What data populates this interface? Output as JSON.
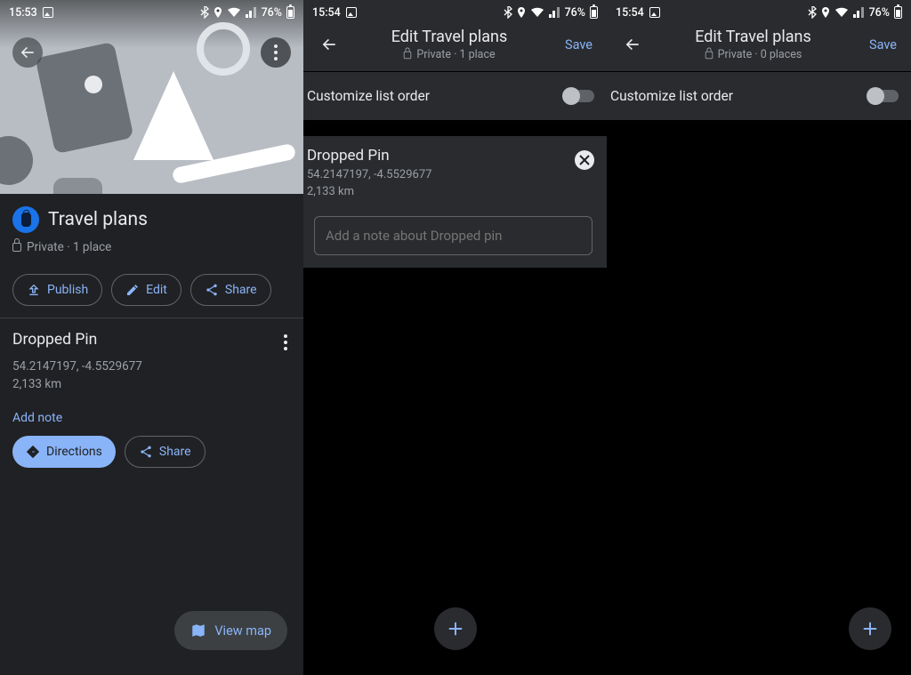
{
  "status": {
    "time1": "15:53",
    "time2": "15:54",
    "time3": "15:54",
    "battery": "76%"
  },
  "pane1": {
    "title": "Travel plans",
    "privacy": "Private · 1 place",
    "actions": {
      "publish": "Publish",
      "edit": "Edit",
      "share": "Share"
    },
    "place": {
      "title": "Dropped Pin",
      "coords": "54.2147197, -4.5529677",
      "distance": "2,133 km",
      "add_note": "Add note",
      "directions": "Directions",
      "share": "Share"
    },
    "view_map": "View map"
  },
  "pane2": {
    "header_title": "Edit Travel plans",
    "header_sub": "Private · 1 place",
    "save": "Save",
    "customize": "Customize list order",
    "pin": {
      "title": "Dropped Pin",
      "coords": "54.2147197, -4.5529677",
      "distance": "2,133 km",
      "note_placeholder": "Add a note about Dropped pin"
    }
  },
  "pane3": {
    "header_title": "Edit Travel plans",
    "header_sub": "Private · 0 places",
    "save": "Save",
    "customize": "Customize list order"
  }
}
